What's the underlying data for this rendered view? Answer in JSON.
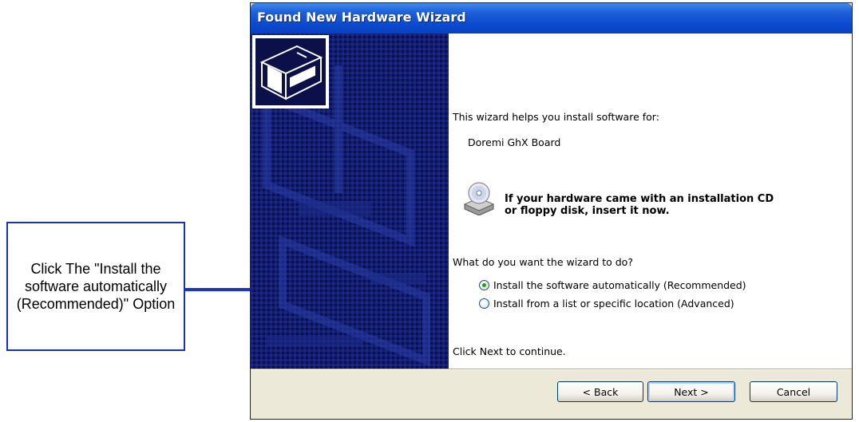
{
  "callout": {
    "text": "Click The \"Install the software automatically (Recommended)\" Option"
  },
  "window": {
    "title": "Found New Hardware Wizard"
  },
  "content": {
    "intro": "This wizard helps you install software for:",
    "device_name": "Doremi GhX Board",
    "cd_notice": "If your hardware came with an installation CD\nor floppy disk, insert it now.",
    "question": "What do you want the wizard to do?",
    "options": [
      {
        "label": "Install the software automatically (Recommended)",
        "selected": true
      },
      {
        "label": "Install from a list or specific location (Advanced)",
        "selected": false
      }
    ],
    "continue_text": "Click Next to continue."
  },
  "buttons": {
    "back": "< Back",
    "next": "Next >",
    "cancel": "Cancel"
  },
  "icons": {
    "hardware": "hardware-box-icon",
    "cd": "cd-drive-icon"
  },
  "colors": {
    "callout_border": "#1b2fbf",
    "arrow": "#1d31d8",
    "titlebar": "#0a4ad0",
    "banner": "#0b0f4a",
    "radio_checked": "#21a121"
  }
}
